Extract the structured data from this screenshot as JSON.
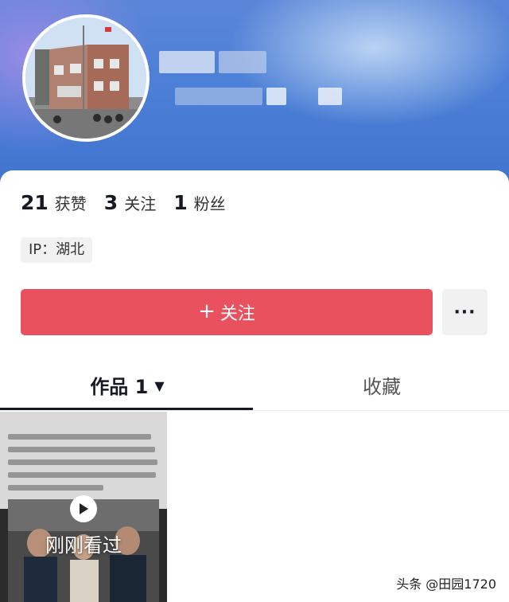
{
  "profile": {
    "stats": [
      {
        "value": "21",
        "label": "获赞"
      },
      {
        "value": "3",
        "label": "关注"
      },
      {
        "value": "1",
        "label": "粉丝"
      }
    ],
    "ip_label": "IP：湖北"
  },
  "actions": {
    "follow_plus": "+",
    "follow_label": "关注",
    "more_label": "···"
  },
  "tabs": [
    {
      "label": "作品 1",
      "caret": "▼"
    },
    {
      "label": "收藏"
    }
  ],
  "video": {
    "watched_label": "刚刚看过",
    "icon": "play-icon"
  },
  "watermark": "头条 @田园1720",
  "colors": {
    "follow_button": "#e9515f",
    "banner": "#4c7fd6"
  }
}
